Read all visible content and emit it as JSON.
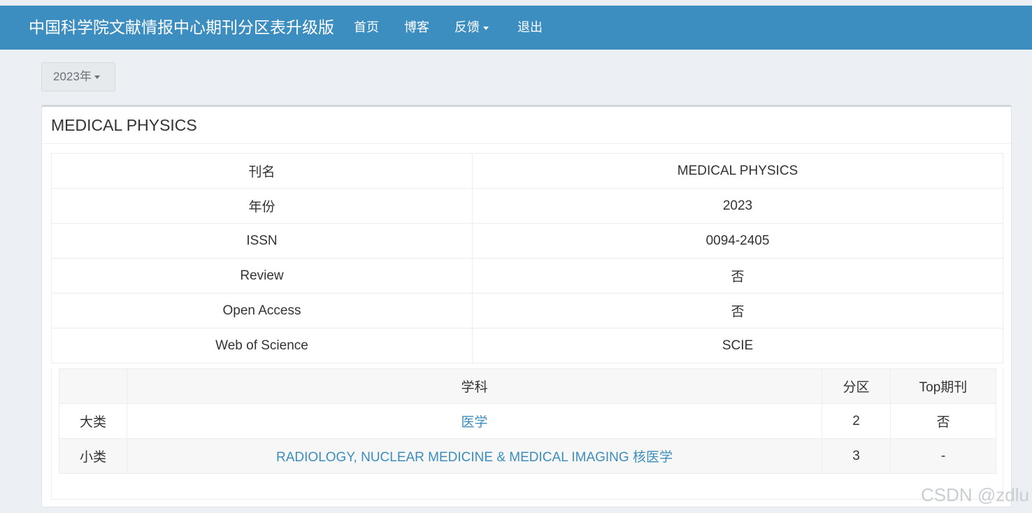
{
  "navbar": {
    "brand": "中国科学院文献情报中心期刊分区表升级版",
    "items": [
      {
        "label": "首页"
      },
      {
        "label": "博客"
      },
      {
        "label": "反馈"
      },
      {
        "label": "退出"
      }
    ]
  },
  "year_selector": {
    "label": "2023年"
  },
  "panel": {
    "title": "MEDICAL PHYSICS"
  },
  "info": {
    "rows": [
      {
        "key": "刊名",
        "value": "MEDICAL PHYSICS"
      },
      {
        "key": "年份",
        "value": "2023"
      },
      {
        "key": "ISSN",
        "value": "0094-2405"
      },
      {
        "key": "Review",
        "value": "否"
      },
      {
        "key": "Open Access",
        "value": "否"
      },
      {
        "key": "Web of Science",
        "value": "SCIE"
      }
    ]
  },
  "categories": {
    "headers": [
      "",
      "学科",
      "分区",
      "Top期刊"
    ],
    "rows": [
      {
        "level": "大类",
        "subject": "医学",
        "zone": "2",
        "top": "否"
      },
      {
        "level": "小类",
        "subject": "RADIOLOGY, NUCLEAR MEDICINE & MEDICAL IMAGING 核医学",
        "zone": "3",
        "top": "-"
      }
    ]
  },
  "watermark": "CSDN @zdlu",
  "colors": {
    "navbar": "#3d8ec0",
    "background": "#eceff3",
    "link": "#3c8dbc"
  }
}
